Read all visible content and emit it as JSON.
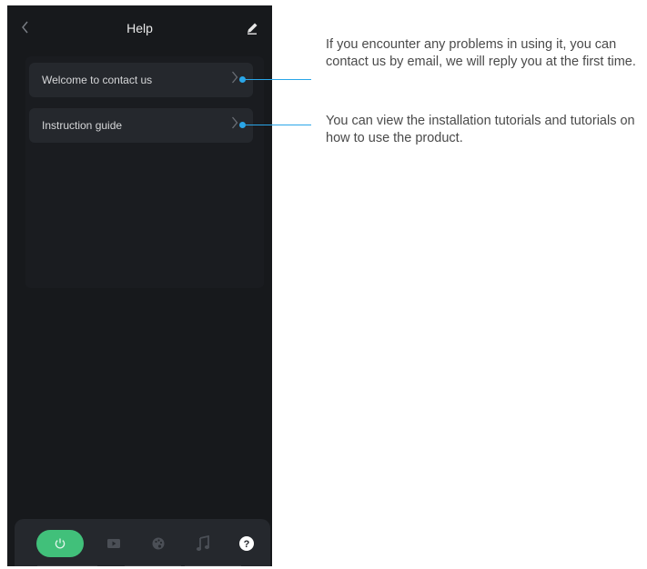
{
  "header": {
    "title": "Help",
    "back_icon": "chevron-left-icon",
    "edit_icon": "pencil-icon"
  },
  "menu": {
    "items": [
      {
        "label": "Welcome to contact us",
        "icon": "chevron-right-icon"
      },
      {
        "label": "Instruction guide",
        "icon": "chevron-right-icon"
      }
    ]
  },
  "annotations": [
    {
      "text": "If you encounter any problems in using it, you can contact us by email, we will reply you at the first time."
    },
    {
      "text": "You can view the installation tutorials and tutorials on how to use the product."
    }
  ],
  "tabbar": {
    "tabs": [
      {
        "icon": "power-icon",
        "active": true
      },
      {
        "icon": "video-icon",
        "active": false
      },
      {
        "icon": "palette-icon",
        "active": false
      },
      {
        "icon": "music-note-icon",
        "active": false
      },
      {
        "icon": "help-icon",
        "active": false
      }
    ]
  },
  "colors": {
    "background": "#17191c",
    "card": "#25282d",
    "accent_green": "#41c07a",
    "callout_blue": "#2aa6e8"
  }
}
